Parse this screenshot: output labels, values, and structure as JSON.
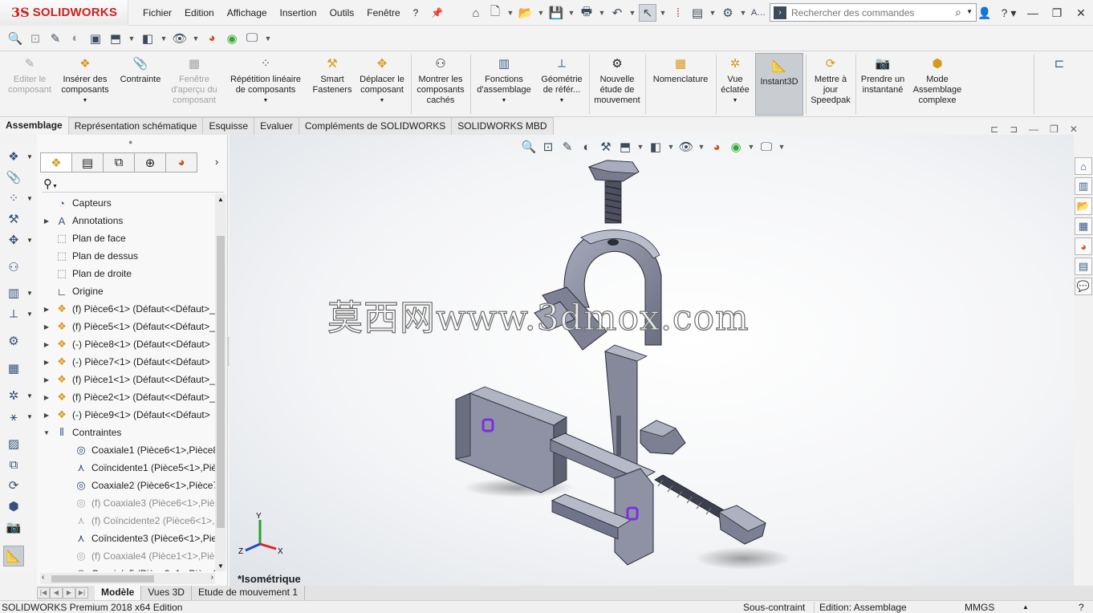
{
  "app": {
    "logo_prefix": "3S",
    "logo_text": "SOLIDWORKS"
  },
  "menu": [
    "Fichier",
    "Edition",
    "Affichage",
    "Insertion",
    "Outils",
    "Fenêtre",
    "?"
  ],
  "search": {
    "placeholder": "Rechercher des commandes"
  },
  "ribbon": [
    {
      "label": "Editer le composant",
      "icon": "edit-component-icon",
      "enabled": false
    },
    {
      "label": "Insérer des composants",
      "icon": "insert-components-icon",
      "enabled": true
    },
    {
      "label": "Contrainte",
      "icon": "mate-paperclip-icon",
      "enabled": true
    },
    {
      "label": "Fenêtre d'aperçu du composant",
      "icon": "preview-window-icon",
      "enabled": false
    },
    {
      "label": "Répétition linéaire de composants",
      "icon": "linear-pattern-icon",
      "enabled": true
    },
    {
      "label": "Smart Fasteners",
      "icon": "smart-fasteners-icon",
      "enabled": true
    },
    {
      "label": "Déplacer le composant",
      "icon": "move-component-icon",
      "enabled": true
    },
    {
      "label": "Montrer les composants cachés",
      "icon": "show-hidden-icon",
      "enabled": true
    },
    {
      "label": "Fonctions d'assemblage",
      "icon": "assembly-features-icon",
      "enabled": true
    },
    {
      "label": "Géométrie de référ...",
      "icon": "reference-geometry-icon",
      "enabled": true
    },
    {
      "label": "Nouvelle étude de mouvement",
      "icon": "motion-study-icon",
      "enabled": true
    },
    {
      "label": "Nomenclature",
      "icon": "bom-icon",
      "enabled": true
    },
    {
      "label": "Vue éclatée",
      "icon": "exploded-view-icon",
      "enabled": true
    },
    {
      "label": "Instant3D",
      "icon": "instant3d-icon",
      "enabled": true,
      "active": true
    },
    {
      "label": "Mettre à jour Speedpak",
      "icon": "speedpak-icon",
      "enabled": true
    },
    {
      "label": "Prendre un instantané",
      "icon": "camera-icon",
      "enabled": true
    },
    {
      "label": "Mode Assemblage complexe",
      "icon": "large-assembly-icon",
      "enabled": true
    }
  ],
  "tabs": [
    "Assemblage",
    "Représentation schématique",
    "Esquisse",
    "Evaluer",
    "Compléments de SOLIDWORKS",
    "SOLIDWORKS MBD"
  ],
  "tree": [
    {
      "label": "Capteurs",
      "icon": "sensor-icon",
      "expand": false,
      "indent": 0
    },
    {
      "label": "Annotations",
      "icon": "annotations-icon",
      "expand": true,
      "indent": 0
    },
    {
      "label": "Plan de face",
      "icon": "plane-icon",
      "expand": false,
      "indent": 0
    },
    {
      "label": "Plan de dessus",
      "icon": "plane-icon",
      "expand": false,
      "indent": 0
    },
    {
      "label": "Plan de droite",
      "icon": "plane-icon",
      "expand": false,
      "indent": 0
    },
    {
      "label": "Origine",
      "icon": "origin-icon",
      "expand": false,
      "indent": 0
    },
    {
      "label": "(f) Pièce6<1> (Défaut<<Défaut>_",
      "icon": "part-icon",
      "expand": true,
      "indent": 0
    },
    {
      "label": "(f) Pièce5<1> (Défaut<<Défaut>_",
      "icon": "part-icon",
      "expand": true,
      "indent": 0
    },
    {
      "label": "(-) Pièce8<1> (Défaut<<Défaut>",
      "icon": "part-icon",
      "expand": true,
      "indent": 0
    },
    {
      "label": "(-) Pièce7<1> (Défaut<<Défaut>",
      "icon": "part-icon",
      "expand": true,
      "indent": 0
    },
    {
      "label": "(f) Pièce1<1> (Défaut<<Défaut>_",
      "icon": "part-icon",
      "expand": true,
      "indent": 0
    },
    {
      "label": "(f) Pièce2<1> (Défaut<<Défaut>_",
      "icon": "part-icon",
      "expand": true,
      "indent": 0
    },
    {
      "label": "(-) Pièce9<1> (Défaut<<Défaut>",
      "icon": "part-icon",
      "expand": true,
      "indent": 0
    },
    {
      "label": "Contraintes",
      "icon": "mates-folder-icon",
      "expand": "open",
      "indent": 0
    },
    {
      "label": "Coaxiale1 (Pièce6<1>,Pièce8",
      "icon": "coaxial-icon",
      "expand": false,
      "indent": 1
    },
    {
      "label": "Coïncidente1 (Pièce5<1>,Piè",
      "icon": "coincident-icon",
      "expand": false,
      "indent": 1
    },
    {
      "label": "Coaxiale2 (Pièce6<1>,Pièce7",
      "icon": "coaxial-icon",
      "expand": false,
      "indent": 1
    },
    {
      "label": "(f) Coaxiale3 (Pièce6<1>,Piè",
      "icon": "coaxial-icon",
      "expand": false,
      "indent": 1,
      "faded": true
    },
    {
      "label": "(f) Coïncidente2 (Pièce6<1>,",
      "icon": "coincident-icon",
      "expand": false,
      "indent": 1,
      "faded": true
    },
    {
      "label": "Coïncidente3 (Pièce6<1>,Pie",
      "icon": "coincident-icon",
      "expand": false,
      "indent": 1
    },
    {
      "label": "(f) Coaxiale4 (Pièce1<1>,Piè",
      "icon": "coaxial-icon",
      "expand": false,
      "indent": 1,
      "faded": true
    },
    {
      "label": "Coaxiale5 (Pièce2<1>,Pièce9",
      "icon": "coaxial-icon",
      "expand": false,
      "indent": 1
    }
  ],
  "viewport": {
    "watermark": "莫西网www.3dmox.com",
    "view_name": "*Isométrique",
    "triad": {
      "x": "X",
      "y": "Y",
      "z": "Z"
    }
  },
  "bottom_tabs": [
    "Modèle",
    "Vues 3D",
    "Etude de mouvement 1"
  ],
  "status": {
    "product": "SOLIDWORKS Premium 2018 x64 Edition",
    "constraint": "Sous-contraint",
    "mode": "Edition: Assemblage",
    "units": "MMGS"
  },
  "colors": {
    "accent": "#cc1f1f",
    "part": "#8f93a6",
    "part_dark": "#5e6274",
    "mate_marker": "#7b2ee0"
  }
}
